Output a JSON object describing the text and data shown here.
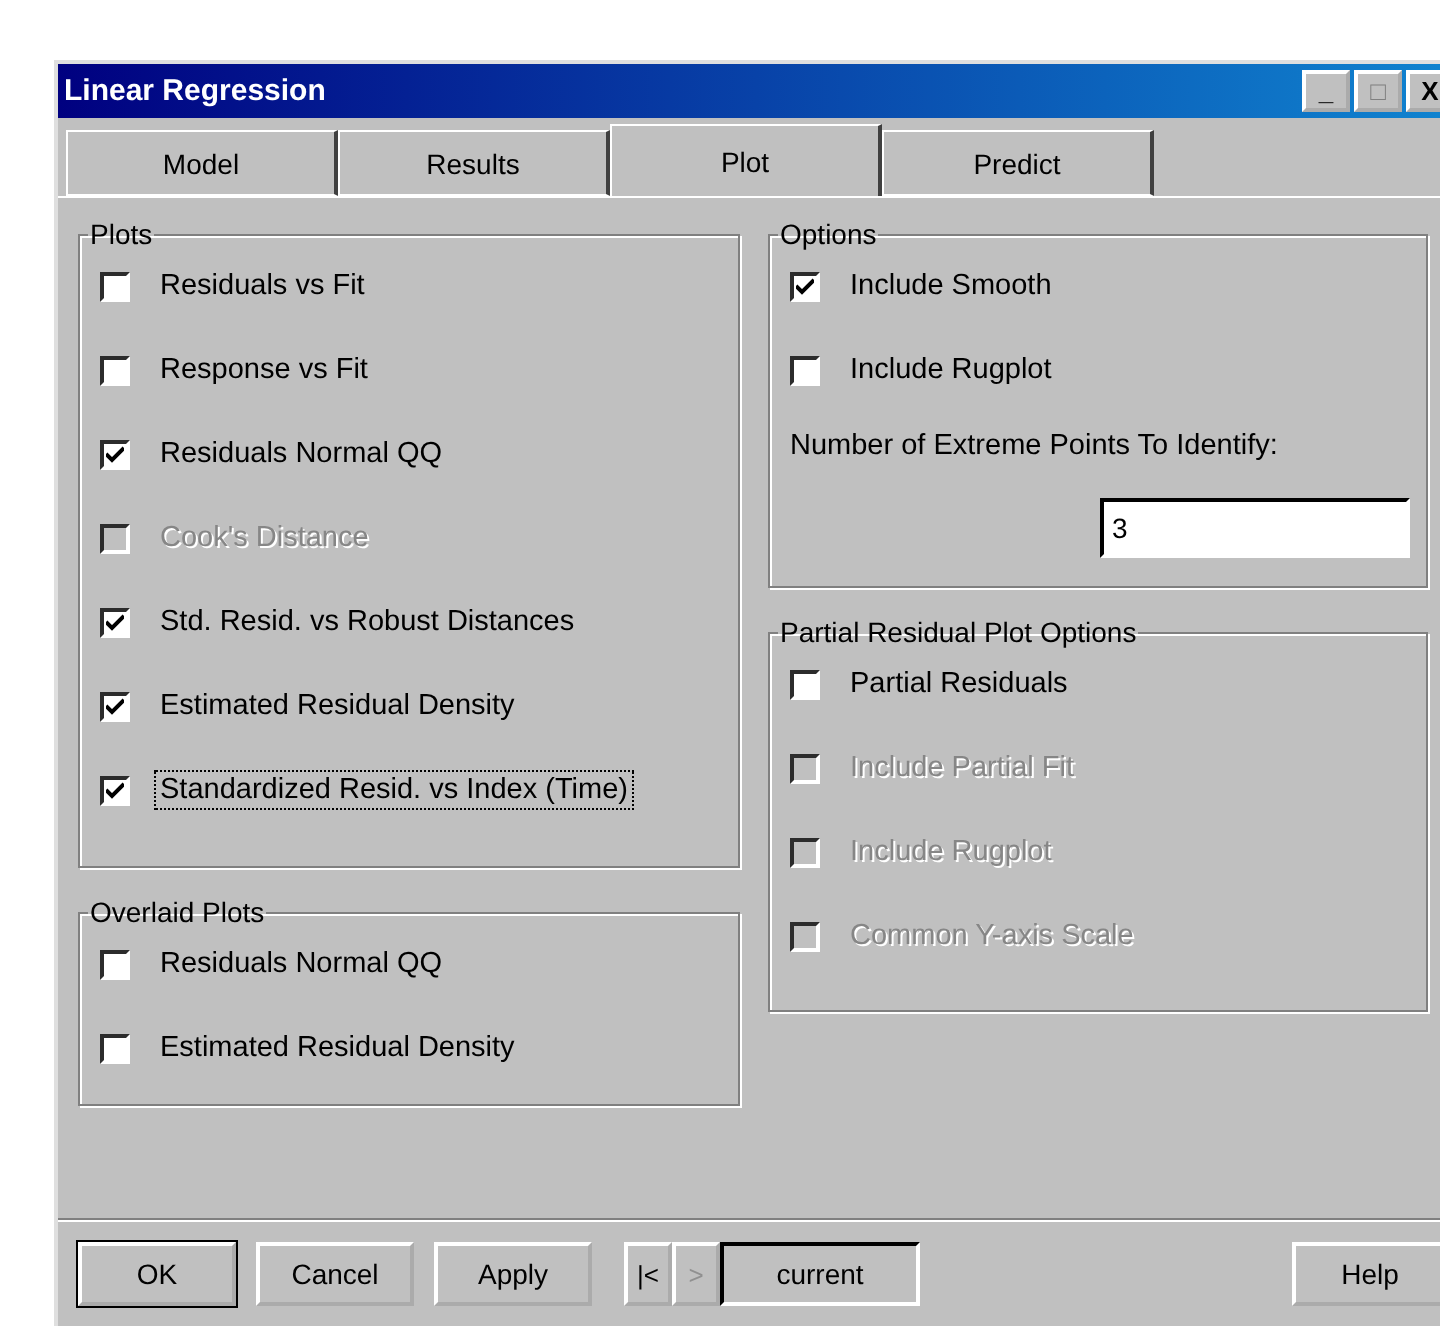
{
  "window": {
    "title": "Linear Regression",
    "controls": [
      "_",
      "□",
      "X"
    ]
  },
  "tabs": [
    {
      "label": "Model",
      "selected": false
    },
    {
      "label": "Results",
      "selected": false
    },
    {
      "label": "Plot",
      "selected": true
    },
    {
      "label": "Predict",
      "selected": false
    }
  ],
  "plots": {
    "title": "Plots",
    "items": [
      {
        "label": "Residuals vs Fit",
        "checked": false,
        "disabled": false,
        "focused": false
      },
      {
        "label": "Response vs Fit",
        "checked": false,
        "disabled": false,
        "focused": false
      },
      {
        "label": "Residuals Normal QQ",
        "checked": true,
        "disabled": false,
        "focused": false
      },
      {
        "label": "Cook's Distance",
        "checked": false,
        "disabled": true,
        "focused": false
      },
      {
        "label": "Std. Resid. vs Robust Distances",
        "checked": true,
        "disabled": false,
        "focused": false
      },
      {
        "label": "Estimated Residual Density",
        "checked": true,
        "disabled": false,
        "focused": false
      },
      {
        "label": "Standardized Resid. vs Index (Time)",
        "checked": true,
        "disabled": false,
        "focused": true
      }
    ]
  },
  "overlaid": {
    "title": "Overlaid Plots",
    "items": [
      {
        "label": "Residuals Normal QQ",
        "checked": false,
        "disabled": false,
        "focused": false
      },
      {
        "label": "Estimated Residual Density",
        "checked": false,
        "disabled": false,
        "focused": false
      }
    ]
  },
  "options": {
    "title": "Options",
    "items": [
      {
        "label": "Include Smooth",
        "checked": true,
        "disabled": false,
        "focused": false
      },
      {
        "label": "Include Rugplot",
        "checked": false,
        "disabled": false,
        "focused": false
      }
    ],
    "field": {
      "label": "Number of Extreme Points To Identify:",
      "value": "3"
    }
  },
  "partial": {
    "title": "Partial Residual Plot Options",
    "items": [
      {
        "label": "Partial Residuals",
        "checked": false,
        "disabled": false,
        "focused": false
      },
      {
        "label": "Include Partial Fit",
        "checked": false,
        "disabled": true,
        "focused": false
      },
      {
        "label": "Include Rugplot",
        "checked": false,
        "disabled": true,
        "focused": false
      },
      {
        "label": "Common Y-axis Scale",
        "checked": false,
        "disabled": true,
        "focused": false
      }
    ]
  },
  "buttons": [
    {
      "label": "OK",
      "kind": "default"
    },
    {
      "label": "Cancel",
      "kind": "normal"
    },
    {
      "label": "Apply",
      "kind": "normal"
    }
  ],
  "navigator": {
    "first": {
      "label": "|<",
      "disabled": false
    },
    "next": {
      "label": ">",
      "disabled": true
    },
    "current": "current"
  },
  "help": "Help"
}
